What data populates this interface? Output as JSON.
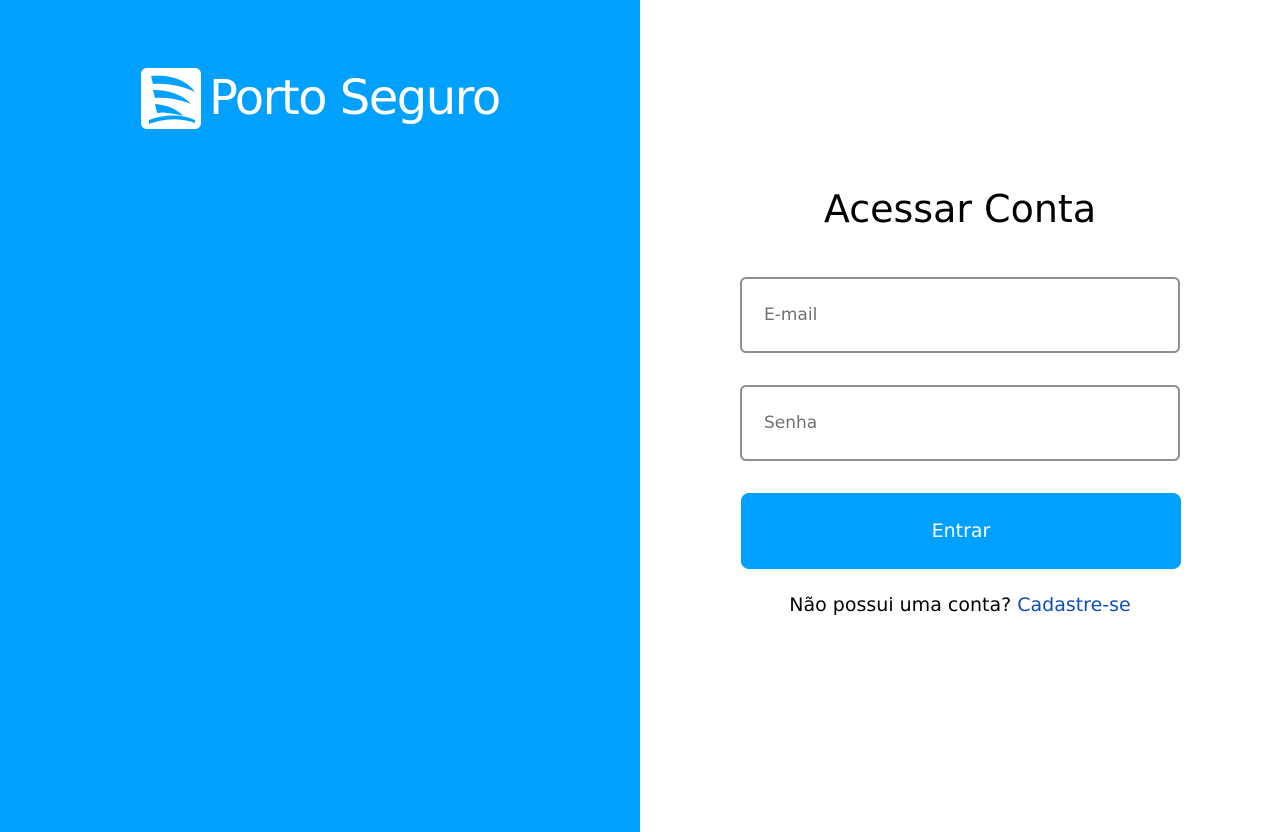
{
  "brand": {
    "name": "Porto Seguro",
    "icon": "porto-seguro-sail-logo",
    "primary_color": "#00a1fe",
    "link_color": "#0b4dbd"
  },
  "login": {
    "title": "Acessar Conta",
    "email": {
      "placeholder": "E-mail",
      "value": ""
    },
    "password": {
      "placeholder": "Senha",
      "value": ""
    },
    "submit_label": "Entrar",
    "signup_prompt": "Não possui uma conta?",
    "signup_link": "Cadastre-se"
  }
}
